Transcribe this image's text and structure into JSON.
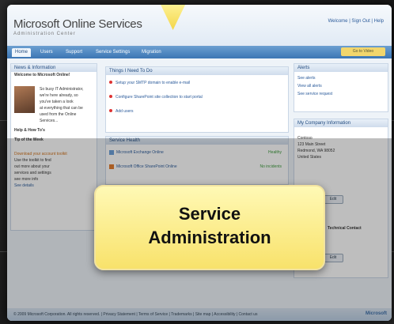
{
  "header": {
    "logo_text": "Microsoft Online Services",
    "logo_sub": "Administration Center",
    "welcome": "Welcome | Sign Out | Help"
  },
  "tabs": [
    {
      "label": "Home"
    },
    {
      "label": "Users"
    },
    {
      "label": "Support"
    },
    {
      "label": "Service Settings"
    },
    {
      "label": "Migration"
    }
  ],
  "tab_right_label": "Go to Video",
  "left_panel": {
    "title": "News & Information",
    "heading": "Welcome to Microsoft Online!",
    "lines": [
      "So busy IT Administrator,",
      "we're here already, so",
      "you've taken a look",
      "at everything that can be",
      "used from the Online",
      "Services..."
    ],
    "sub_heading": "Help & How To's",
    "tip_title": "Tip of the Week",
    "orange_text": "Download your account toolkit",
    "more_lines": [
      "Use the toolkit to find",
      "out more about your",
      "services and settings",
      "see more info"
    ],
    "link": "See details"
  },
  "mid_panel": {
    "title": "Things I Need To Do",
    "items": [
      "Setup your SMTP domain to enable e-mail",
      "Configure SharePoint site collection to start portal",
      "Add users"
    ]
  },
  "svc_panel": {
    "title": "Service Health",
    "items": [
      {
        "name": "Microsoft Exchange Online",
        "status": "Healthy"
      },
      {
        "name": "Microsoft Office SharePoint Online",
        "status": "No incidents"
      }
    ]
  },
  "right_panel": {
    "title": "Alerts",
    "links": [
      "See alerts",
      "View all alerts",
      "See service request"
    ]
  },
  "company_panel": {
    "title": "My Company Information",
    "lines": [
      "Contoso",
      "123 Main Street",
      "Redmond, WA 98052",
      "United States"
    ],
    "button": "Edit",
    "contact_title": "Technical Contact",
    "contact_button": "Edit"
  },
  "footer": {
    "text": "© 2009 Microsoft Corporation. All rights reserved. | Privacy Statement | Terms of Service | Trademarks | Site map | Accessibility | Contact us",
    "brand": "Microsoft"
  },
  "callout": {
    "line1": "Service",
    "line2": "Administration"
  }
}
